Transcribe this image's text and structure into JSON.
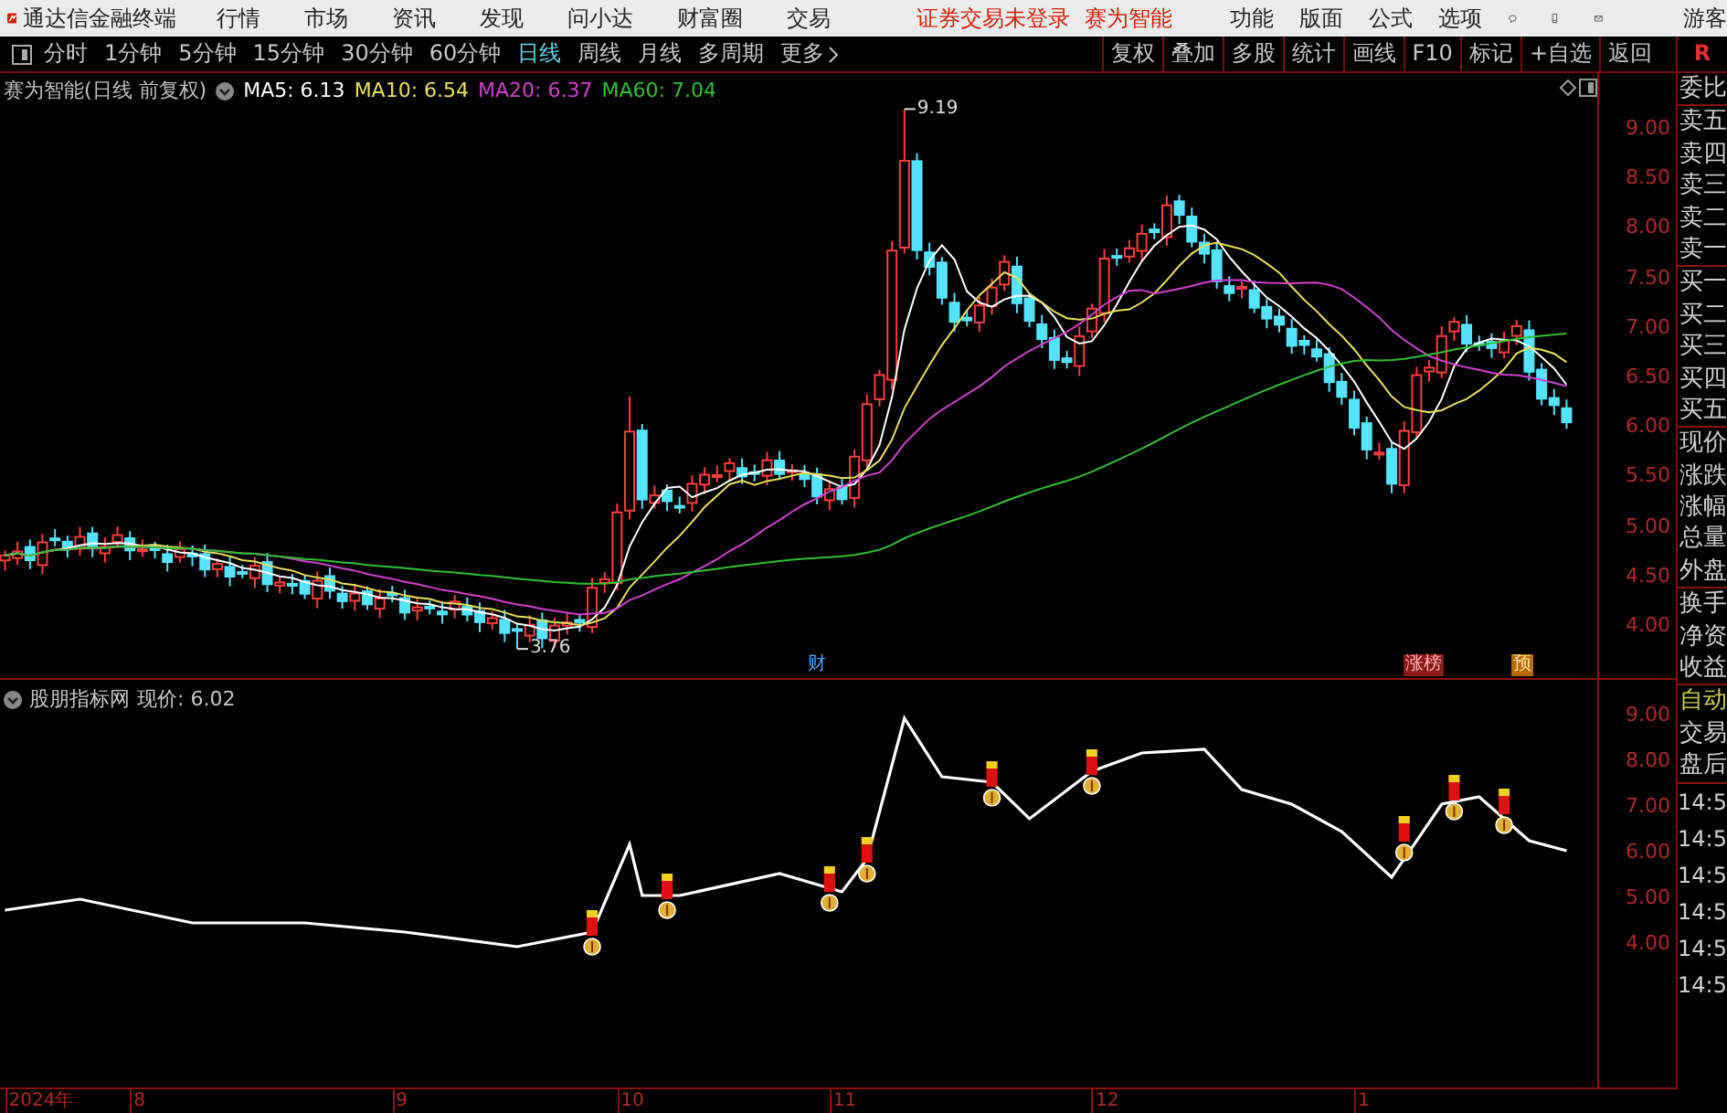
{
  "menu_bar": {
    "app_name": "通达信金融终端",
    "menus": [
      "行情",
      "市场",
      "资讯",
      "发现",
      "问小达",
      "财富圈",
      "交易"
    ],
    "login_status": "证券交易未登录",
    "stock_name": "赛为智能",
    "tools": [
      "功能",
      "版面",
      "公式",
      "选项"
    ],
    "user": "游客"
  },
  "toolbar": {
    "periods": [
      {
        "label": "分时",
        "selected": false
      },
      {
        "label": "1分钟",
        "selected": false
      },
      {
        "label": "5分钟",
        "selected": false
      },
      {
        "label": "15分钟",
        "selected": false
      },
      {
        "label": "30分钟",
        "selected": false
      },
      {
        "label": "60分钟",
        "selected": false
      },
      {
        "label": "日线",
        "selected": true
      },
      {
        "label": "周线",
        "selected": false
      },
      {
        "label": "月线",
        "selected": false
      },
      {
        "label": "多周期",
        "selected": false
      }
    ],
    "more": "更多",
    "actions": [
      "复权",
      "叠加",
      "多股",
      "统计",
      "画线",
      "F10",
      "标记",
      "+自选",
      "返回"
    ],
    "panel_toggle": "R"
  },
  "price_chart": {
    "title": "赛为智能(日线 前复权)",
    "moving_averages": [
      {
        "label": "MA5: 6.13",
        "color": "#ffffff"
      },
      {
        "label": "MA10: 6.54",
        "color": "#e8e05a"
      },
      {
        "label": "MA20: 6.37",
        "color": "#d040d0"
      },
      {
        "label": "MA60: 7.04",
        "color": "#30c030"
      }
    ],
    "high_label": "9.19",
    "low_label": "3.76",
    "yticks": [
      "9.00",
      "8.50",
      "8.00",
      "7.50",
      "7.00",
      "6.50",
      "6.00",
      "5.50",
      "5.00",
      "4.50",
      "4.00"
    ],
    "events": [
      {
        "label": "财",
        "kind": "finance"
      },
      {
        "label": "涨榜",
        "kind": "ranking"
      },
      {
        "label": "预",
        "kind": "forecast"
      }
    ]
  },
  "indicator": {
    "title": "股朋指标网",
    "reading": "现价: 6.02",
    "yticks": [
      "9.00",
      "8.00",
      "7.00",
      "6.00",
      "5.00",
      "4.00"
    ]
  },
  "date_axis": [
    "2024年",
    "8",
    "9",
    "10",
    "11",
    "12",
    "1"
  ],
  "side_panel": {
    "quote_groups": [
      [
        "委比"
      ],
      [
        "卖五",
        "卖四",
        "卖三",
        "卖二",
        "卖一"
      ],
      [
        "买一",
        "买二",
        "买三",
        "买四",
        "买五"
      ],
      [
        "现价",
        "涨跌",
        "涨幅",
        "总量",
        "外盘"
      ],
      [
        "换手",
        "净资",
        "收益"
      ]
    ],
    "mode": "自动",
    "labels": [
      "交易",
      "盘后"
    ],
    "times": [
      "14:5",
      "14:5",
      "14:5",
      "14:5",
      "14:5",
      "14:5"
    ]
  }
}
